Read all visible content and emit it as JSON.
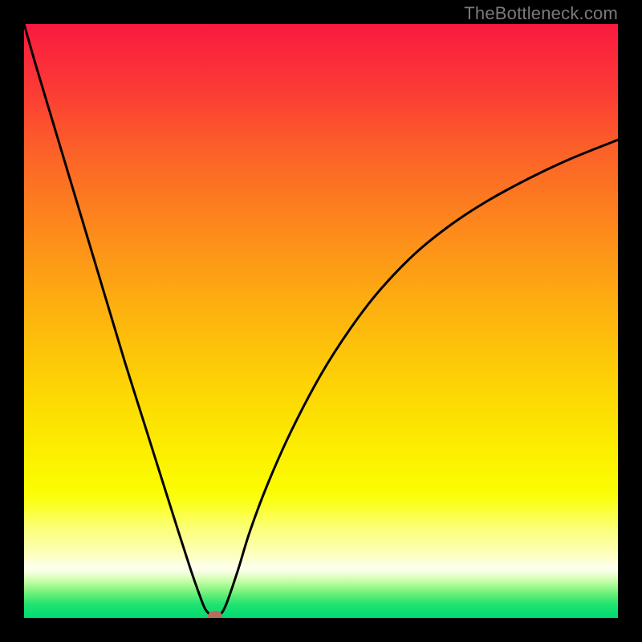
{
  "watermark": "TheBottleneck.com",
  "chart_data": {
    "type": "line",
    "title": "",
    "xlabel": "",
    "ylabel": "",
    "xlim": [
      0,
      100
    ],
    "ylim": [
      0,
      100
    ],
    "series": [
      {
        "name": "bottleneck-curve",
        "x": [
          0,
          2,
          5,
          8,
          11,
          14,
          17,
          20,
          23,
          26,
          28,
          29.5,
          30.5,
          31.5,
          32.2,
          33,
          34,
          36,
          38,
          41,
          45,
          50,
          55,
          60,
          66,
          72,
          78,
          85,
          92,
          100
        ],
        "values": [
          100,
          93,
          83,
          73,
          63,
          53,
          43,
          33.5,
          24,
          14.5,
          8.3,
          4,
          1.5,
          0.4,
          0,
          0.5,
          2.2,
          8,
          14.5,
          22.5,
          31.5,
          41,
          48.8,
          55.3,
          61.5,
          66.3,
          70.2,
          74,
          77.3,
          80.5
        ]
      }
    ],
    "marker": {
      "x": 32.2,
      "y": 0,
      "color": "#b56e5c"
    },
    "gradient_stops": [
      {
        "pct": 0,
        "color": "#fa1a3f"
      },
      {
        "pct": 10,
        "color": "#fb3736"
      },
      {
        "pct": 22,
        "color": "#fc6328"
      },
      {
        "pct": 35,
        "color": "#fd8b1b"
      },
      {
        "pct": 48,
        "color": "#fdb10f"
      },
      {
        "pct": 61,
        "color": "#fdd405"
      },
      {
        "pct": 72,
        "color": "#fcef00"
      },
      {
        "pct": 78,
        "color": "#fbfc00"
      },
      {
        "pct": 80,
        "color": "#fbff12"
      },
      {
        "pct": 85,
        "color": "#fbff7a"
      },
      {
        "pct": 89,
        "color": "#fcffb8"
      },
      {
        "pct": 91.2,
        "color": "#feffe8"
      },
      {
        "pct": 92.0,
        "color": "#faffea"
      },
      {
        "pct": 92.8,
        "color": "#e7ffcd"
      },
      {
        "pct": 93.7,
        "color": "#c9feac"
      },
      {
        "pct": 94.8,
        "color": "#9df88d"
      },
      {
        "pct": 96.2,
        "color": "#5cee76"
      },
      {
        "pct": 97.8,
        "color": "#1ee271"
      },
      {
        "pct": 100,
        "color": "#00db72"
      }
    ]
  }
}
